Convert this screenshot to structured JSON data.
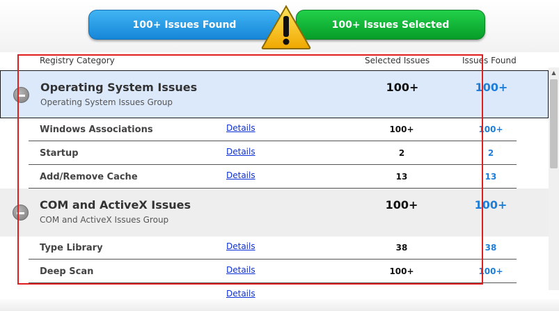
{
  "summary": {
    "found_label": "100+ Issues Found",
    "selected_label": "100+ Issues Selected",
    "colors": {
      "found": "#1686d8",
      "selected": "#069d28",
      "warning": "#f7c600",
      "highlight": "#e01e1e"
    }
  },
  "columns": {
    "category": "Registry Category",
    "selected": "Selected Issues",
    "found": "Issues Found"
  },
  "groups": [
    {
      "title": "Operating System Issues",
      "subtitle": "Operating System Issues Group",
      "selected": "100+",
      "found": "100+",
      "items": [
        {
          "name": "Windows Associations",
          "details": "Details",
          "selected": "100+",
          "found": "100+"
        },
        {
          "name": "Startup",
          "details": "Details",
          "selected": "2",
          "found": "2"
        },
        {
          "name": "Add/Remove Cache",
          "details": "Details",
          "selected": "13",
          "found": "13"
        }
      ]
    },
    {
      "title": "COM and ActiveX Issues",
      "subtitle": "COM and ActiveX Issues Group",
      "selected": "100+",
      "found": "100+",
      "items": [
        {
          "name": "Type Library",
          "details": "Details",
          "selected": "38",
          "found": "38"
        },
        {
          "name": "Deep Scan",
          "details": "Details",
          "selected": "100+",
          "found": "100+"
        },
        {
          "name": "",
          "details": "Details",
          "selected": "",
          "found": ""
        }
      ]
    }
  ]
}
